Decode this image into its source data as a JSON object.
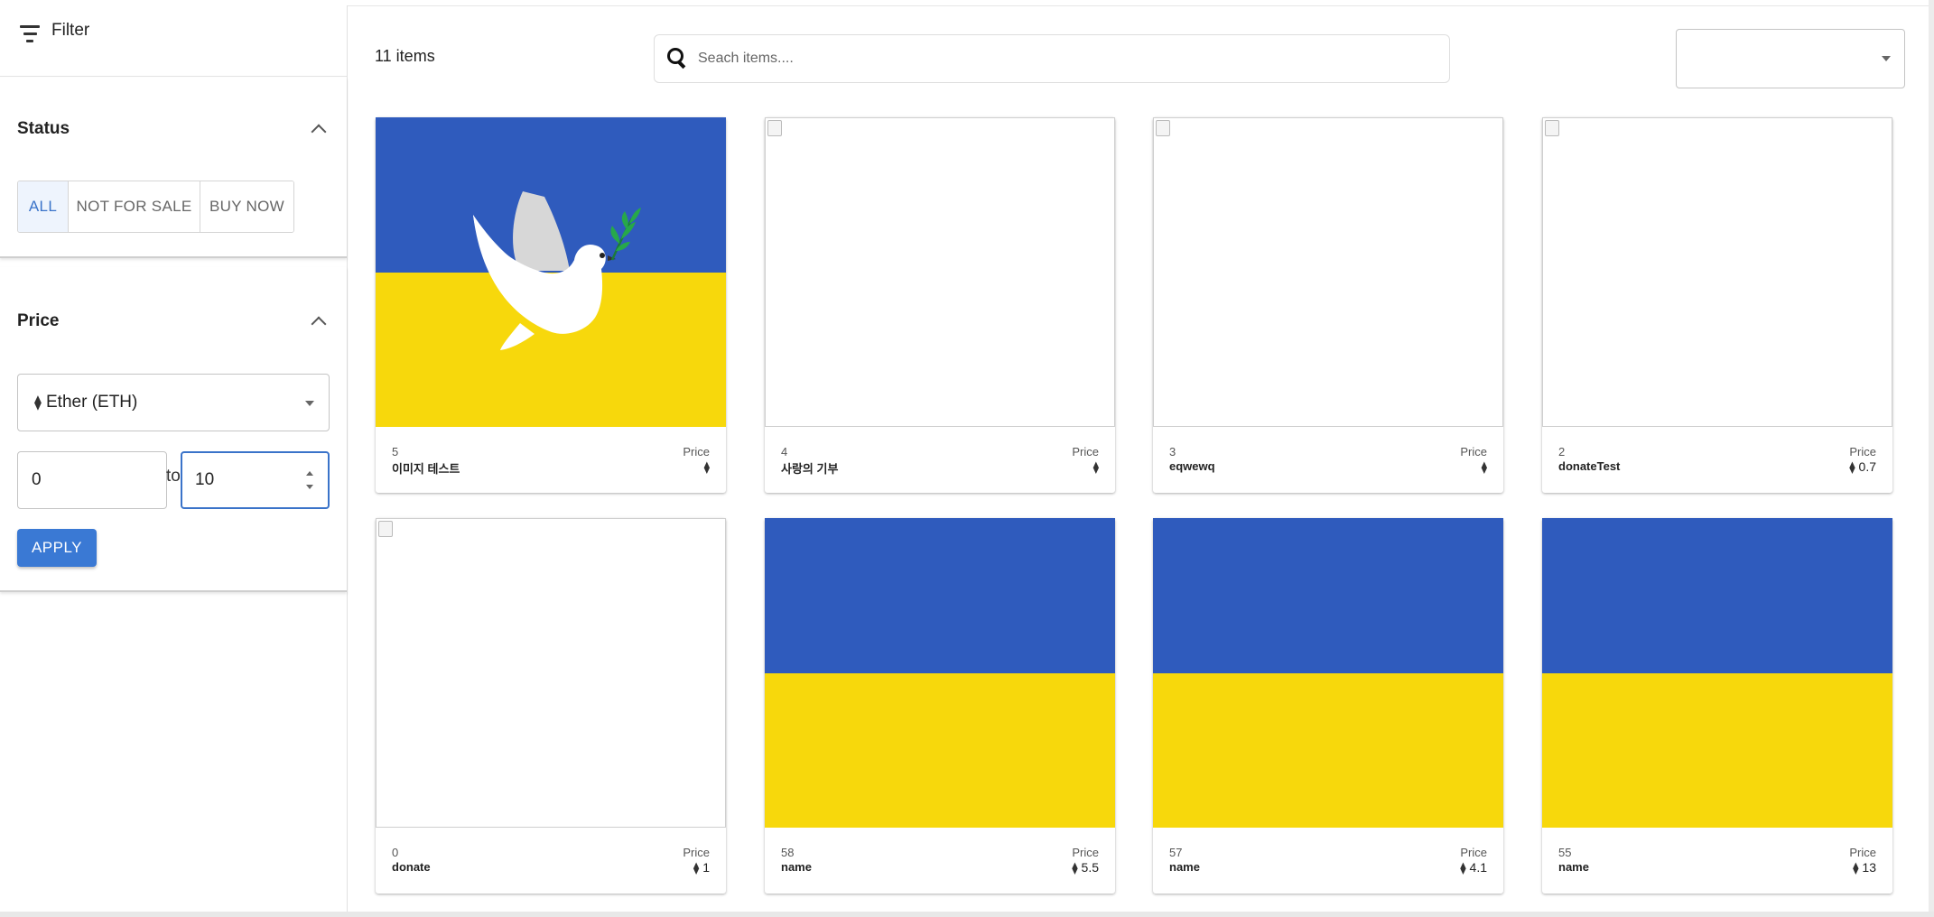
{
  "sidebar": {
    "filter_label": "Filter",
    "status": {
      "title": "Status",
      "options": [
        "ALL",
        "NOT FOR SALE",
        "BUY NOW"
      ],
      "selected": "ALL"
    },
    "price": {
      "title": "Price",
      "currency_icon": "ethereum-icon",
      "currency_label": "Ether (ETH)",
      "min_value": "0",
      "to_label": "to",
      "max_value": "10",
      "apply_label": "APPLY"
    }
  },
  "main": {
    "items_count": "11 items",
    "search_placeholder": "Seach items....",
    "sort_value": ""
  },
  "cards": [
    {
      "id": "5",
      "name": "이미지 테스트",
      "price_label": "Price",
      "price": "",
      "image": "dove-flag"
    },
    {
      "id": "4",
      "name": "사랑의 기부",
      "price_label": "Price",
      "price": "",
      "image": "broken"
    },
    {
      "id": "3",
      "name": "eqwewq",
      "price_label": "Price",
      "price": "",
      "image": "broken"
    },
    {
      "id": "2",
      "name": "donateTest",
      "price_label": "Price",
      "price": "0.7",
      "image": "broken"
    },
    {
      "id": "0",
      "name": "donate",
      "price_label": "Price",
      "price": "1",
      "image": "broken"
    },
    {
      "id": "58",
      "name": "name",
      "price_label": "Price",
      "price": "5.5",
      "image": "flag"
    },
    {
      "id": "57",
      "name": "name",
      "price_label": "Price",
      "price": "4.1",
      "image": "flag"
    },
    {
      "id": "55",
      "name": "name",
      "price_label": "Price",
      "price": "13",
      "image": "flag"
    }
  ],
  "colors": {
    "accent": "#3a79d4",
    "flag_blue": "#2f5bbd",
    "flag_yellow": "#f7d80c"
  }
}
